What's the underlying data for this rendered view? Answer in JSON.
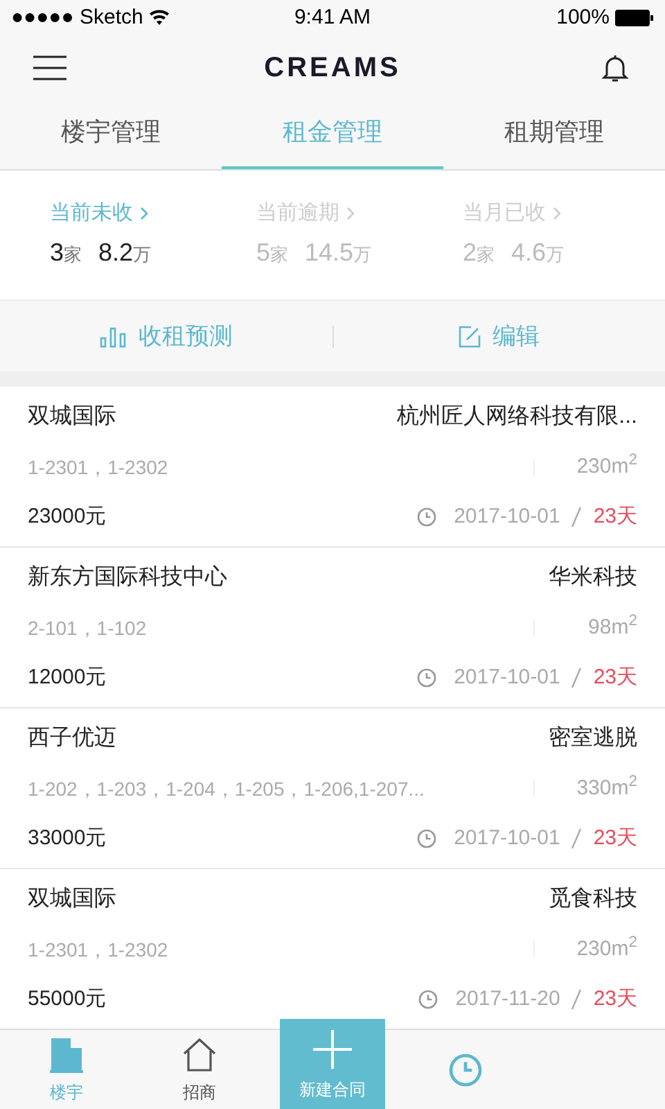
{
  "status_bar": {
    "carrier": "●●●●● Sketch",
    "time": "9:41 AM",
    "battery": "100%"
  },
  "header": {
    "title": "CREAMS"
  },
  "tabs": [
    {
      "label": "楼宇管理",
      "selected": false
    },
    {
      "label": "租金管理",
      "selected": true
    },
    {
      "label": "租期管理",
      "selected": false
    }
  ],
  "stats": [
    {
      "label": "当前未收",
      "count": "3",
      "count_unit": "家",
      "amount": "8.2",
      "amount_unit": "万",
      "selected": true
    },
    {
      "label": "当前逾期",
      "count": "5",
      "count_unit": "家",
      "amount": "14.5",
      "amount_unit": "万",
      "selected": false
    },
    {
      "label": "当月已收",
      "count": "2",
      "count_unit": "家",
      "amount": "4.6",
      "amount_unit": "万",
      "selected": false
    }
  ],
  "actions": [
    {
      "kind": "chart",
      "label": "收租预测"
    },
    {
      "kind": "edit",
      "label": "编辑"
    }
  ],
  "contracts": [
    {
      "building": "双城国际",
      "tenant": "杭州匠人网络科技有限...",
      "units": "1-2301，1-2302",
      "area": "230m$^{2}$",
      "rent": "23000元",
      "date": "2017-10-01",
      "days": "23天"
    },
    {
      "building": "新东方国际科技中心",
      "tenant": "华米科技",
      "units": "2-101，1-102",
      "area": "98m$^{2}$",
      "rent": "12000元",
      "date": "2017-10-01",
      "days": "23天"
    },
    {
      "building": "西子优迈",
      "tenant": "密室逃脱",
      "units": "1-202，1-203，1-204，1-205，1-206,1-207...",
      "area": "330m$^{2}$",
      "rent": "33000元",
      "date": "2017-10-01",
      "days": "23天"
    },
    {
      "building": "双城国际",
      "tenant": "觅食科技",
      "units": "1-2301，1-2302",
      "area": "230m$^{2}$",
      "rent": "55000元",
      "date": "2017-11-20",
      "days": "23天"
    }
  ],
  "bottom_nav": [
    {
      "kind": "building",
      "label": "楼宇",
      "selected": true
    },
    {
      "kind": "house",
      "label": "招商",
      "selected": false
    },
    {
      "kind": "add",
      "label": "新建合同"
    },
    {
      "kind": "clock"
    }
  ]
}
